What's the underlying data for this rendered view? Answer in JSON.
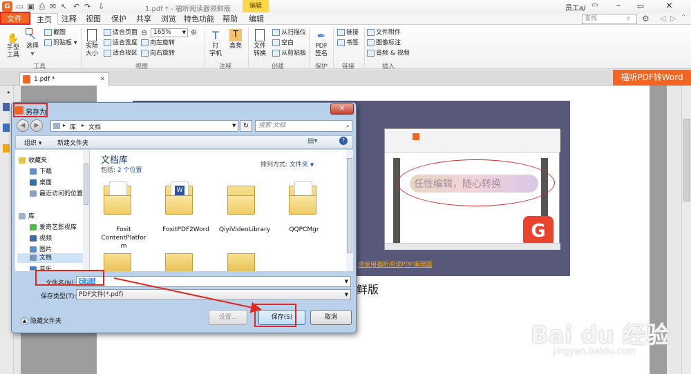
{
  "app": {
    "title": "1.pdf * - 福昕阅读器领鲜版",
    "context_tab": "编辑",
    "user": "员工a/",
    "search_placeholder": "查找",
    "file_tab": "文件",
    "tabs": [
      "主页",
      "注释",
      "视图",
      "保护",
      "共享",
      "浏览",
      "特色功能",
      "帮助",
      "编辑"
    ],
    "accent_color": "#f26522",
    "highlight_color": "#e0281f"
  },
  "ribbon": {
    "hand_tool": "手型\n工具",
    "select": "选择",
    "screenshot": "截图",
    "clipboard": "剪贴板",
    "actual_size": "实际\n大小",
    "fit_page": "适合页面",
    "fit_width": "适合宽度",
    "fit_visible": "适合视区",
    "zoom_value": "165%",
    "rotate_left": "向左旋转",
    "rotate_right": "向右旋转",
    "typewriter": "打\n字机",
    "highlight": "高亮",
    "file_convert": "文件\n转换",
    "from_scanner": "从扫描仪",
    "blank": "空白",
    "from_clipboard": "从剪贴板",
    "pdf_sign": "PDF\n签名",
    "link": "链接",
    "bookmark": "书签",
    "file_attachment": "文件附件",
    "image_annotation": "图像标注",
    "audio_video": "音频 & 视频",
    "groups": {
      "tools": "工具",
      "view": "视图",
      "comment": "注释",
      "create": "创建",
      "protect": "保护",
      "links": "链接",
      "insert": "插入"
    }
  },
  "document": {
    "tab_label": "1.pdf *",
    "promo_button": "福听PDF转Word",
    "thumbnail_text": "任性编辑，随心转换",
    "caption_link": "请使用福昕阅读PDF编辑器",
    "body_text": "鲜版"
  },
  "dialog": {
    "title": "另存为",
    "breadcrumb": [
      "库",
      "文档"
    ],
    "search_placeholder": "搜索 文档",
    "organize": "组织",
    "new_folder": "新建文件夹",
    "library_title": "文档库",
    "includes": "包括: ",
    "includes_link": "2 个位置",
    "sort_label": "排列方式: ",
    "sort_value": "文件夹",
    "favorites": "收藏夹",
    "favorites_items": [
      "下载",
      "桌面",
      "最近访问的位置"
    ],
    "libraries": "库",
    "library_items": [
      "爱奇艺影视库",
      "视频",
      "图片",
      "文档",
      "音乐"
    ],
    "folders": [
      "Foxit\nContentPlatfor\nm",
      "FoxitPDF2Word",
      "QiyiVideoLibrary",
      "QQPCMgr"
    ],
    "filename_label": "文件名(N):",
    "filename_value": "更新1",
    "filetype_label": "保存类型(T):",
    "filetype_value": "PDF文件(*.pdf)",
    "hide_folders": "隐藏文件夹",
    "settings_button": "设置...",
    "save_button": "保存(S)",
    "cancel_button": "取消"
  },
  "watermark": {
    "logo": "Bai du 经验",
    "url": "jingyan.baidu.com"
  }
}
